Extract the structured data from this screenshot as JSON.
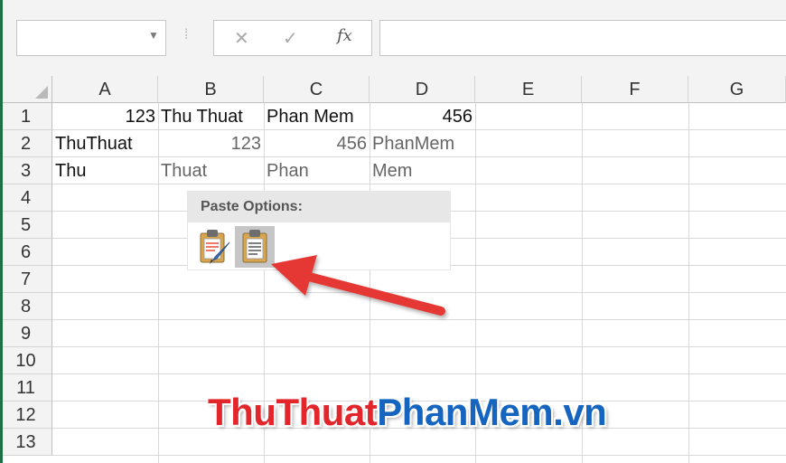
{
  "formula_bar": {
    "name_box_value": "",
    "cancel_icon": "✕",
    "enter_icon": "✓",
    "fx_label": "fx",
    "formula_value": ""
  },
  "columns": [
    "A",
    "B",
    "C",
    "D",
    "E",
    "F",
    "G"
  ],
  "rows": [
    "1",
    "2",
    "3",
    "4",
    "5",
    "6",
    "7",
    "8",
    "9",
    "10",
    "11",
    "12",
    "13"
  ],
  "cells": {
    "A1": "123",
    "B1": "Thu Thuat",
    "C1": "Phan Mem",
    "D1": "456",
    "A2": "ThuThuat",
    "B2": "123",
    "C2": "456",
    "D2": "PhanMem",
    "A3": "Thu",
    "B3": "Thuat",
    "C3": "Phan",
    "D3": "Mem"
  },
  "paste_options": {
    "title": "Paste Options:",
    "buttons": [
      "keep-source-formatting-icon",
      "match-destination-formatting-icon"
    ]
  },
  "watermark": {
    "part1": "ThuThuat",
    "part2": "PhanMem.vn"
  },
  "colors": {
    "excel_green": "#1e7145",
    "arrow_red": "#e53935",
    "watermark_red": "#e3262b",
    "watermark_blue": "#1565c0"
  }
}
